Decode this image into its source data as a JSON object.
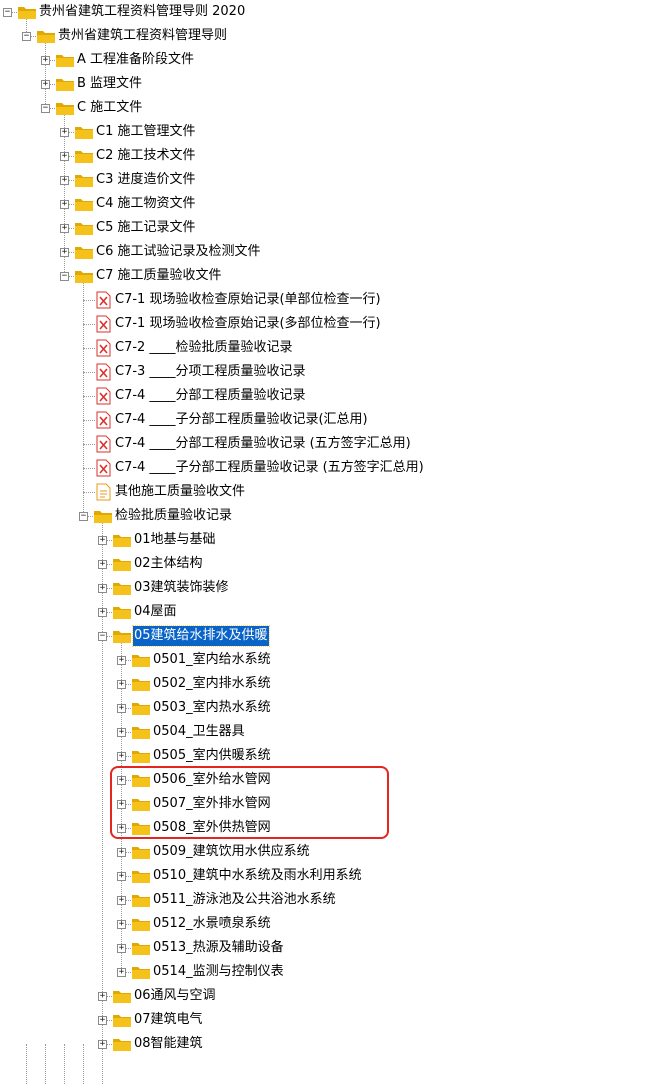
{
  "tree": {
    "items": [
      {
        "level": 0,
        "type": "folder",
        "open": true,
        "label": "贵州省建筑工程资料管理导则 2020"
      },
      {
        "level": 1,
        "type": "folder",
        "open": true,
        "label": "贵州省建筑工程资料管理导则"
      },
      {
        "level": 2,
        "type": "folder",
        "open": false,
        "label": "A  工程准备阶段文件"
      },
      {
        "level": 2,
        "type": "folder",
        "open": false,
        "label": "B  监理文件"
      },
      {
        "level": 2,
        "type": "folder",
        "open": true,
        "label": "C  施工文件"
      },
      {
        "level": 3,
        "type": "folder",
        "open": false,
        "label": "C1  施工管理文件"
      },
      {
        "level": 3,
        "type": "folder",
        "open": false,
        "label": "C2  施工技术文件"
      },
      {
        "level": 3,
        "type": "folder",
        "open": false,
        "label": "C3  进度造价文件"
      },
      {
        "level": 3,
        "type": "folder",
        "open": false,
        "label": "C4  施工物资文件"
      },
      {
        "level": 3,
        "type": "folder",
        "open": false,
        "label": "C5  施工记录文件"
      },
      {
        "level": 3,
        "type": "folder",
        "open": false,
        "label": "C6  施工试验记录及检测文件"
      },
      {
        "level": 3,
        "type": "folder",
        "open": true,
        "label": "C7  施工质量验收文件"
      },
      {
        "level": 4,
        "type": "excel",
        "label": "C7-1  现场验收检查原始记录(单部位检查一行)"
      },
      {
        "level": 4,
        "type": "excel",
        "label": "C7-1  现场验收检查原始记录(多部位检查一行)"
      },
      {
        "level": 4,
        "type": "excel",
        "label": "C7-2  ____检验批质量验收记录"
      },
      {
        "level": 4,
        "type": "excel",
        "label": "C7-3  ____分项工程质量验收记录"
      },
      {
        "level": 4,
        "type": "excel",
        "label": "C7-4  ____分部工程质量验收记录"
      },
      {
        "level": 4,
        "type": "excel",
        "label": "C7-4  ____子分部工程质量验收记录(汇总用)"
      },
      {
        "level": 4,
        "type": "excel",
        "label": "C7-4  ____分部工程质量验收记录  (五方签字汇总用)"
      },
      {
        "level": 4,
        "type": "excel",
        "label": "C7-4  ____子分部工程质量验收记录  (五方签字汇总用)"
      },
      {
        "level": 4,
        "type": "doc",
        "label": "其他施工质量验收文件"
      },
      {
        "level": 4,
        "type": "folder",
        "open": true,
        "label": "检验批质量验收记录"
      },
      {
        "level": 5,
        "type": "folder",
        "open": false,
        "label": "01地基与基础"
      },
      {
        "level": 5,
        "type": "folder",
        "open": false,
        "label": "02主体结构"
      },
      {
        "level": 5,
        "type": "folder",
        "open": false,
        "label": "03建筑装饰装修"
      },
      {
        "level": 5,
        "type": "folder",
        "open": false,
        "label": "04屋面"
      },
      {
        "level": 5,
        "type": "folder",
        "open": true,
        "label": "05建筑给水排水及供暖",
        "selected": true
      },
      {
        "level": 6,
        "type": "folder",
        "open": false,
        "label": "0501_室内给水系统"
      },
      {
        "level": 6,
        "type": "folder",
        "open": false,
        "label": "0502_室内排水系统"
      },
      {
        "level": 6,
        "type": "folder",
        "open": false,
        "label": "0503_室内热水系统"
      },
      {
        "level": 6,
        "type": "folder",
        "open": false,
        "label": "0504_卫生器具"
      },
      {
        "level": 6,
        "type": "folder",
        "open": false,
        "label": "0505_室内供暖系统"
      },
      {
        "level": 6,
        "type": "folder",
        "open": false,
        "label": "0506_室外给水管网"
      },
      {
        "level": 6,
        "type": "folder",
        "open": false,
        "label": "0507_室外排水管网"
      },
      {
        "level": 6,
        "type": "folder",
        "open": false,
        "label": "0508_室外供热管网"
      },
      {
        "level": 6,
        "type": "folder",
        "open": false,
        "label": "0509_建筑饮用水供应系统"
      },
      {
        "level": 6,
        "type": "folder",
        "open": false,
        "label": "0510_建筑中水系统及雨水利用系统"
      },
      {
        "level": 6,
        "type": "folder",
        "open": false,
        "label": "0511_游泳池及公共浴池水系统"
      },
      {
        "level": 6,
        "type": "folder",
        "open": false,
        "label": "0512_水景喷泉系统"
      },
      {
        "level": 6,
        "type": "folder",
        "open": false,
        "label": "0513_热源及辅助设备"
      },
      {
        "level": 6,
        "type": "folder",
        "open": false,
        "label": "0514_监测与控制仪表"
      },
      {
        "level": 5,
        "type": "folder",
        "open": false,
        "label": "06通风与空调"
      },
      {
        "level": 5,
        "type": "folder",
        "open": false,
        "label": "07建筑电气"
      },
      {
        "level": 5,
        "type": "folder",
        "open": false,
        "label": "08智能建筑"
      }
    ]
  },
  "colors": {
    "folder": "#f5c21b",
    "folder_dark": "#e0a800",
    "excel_icon": "#d9312b",
    "selection": "#0a64c8",
    "highlight_box": "#e3261e"
  }
}
